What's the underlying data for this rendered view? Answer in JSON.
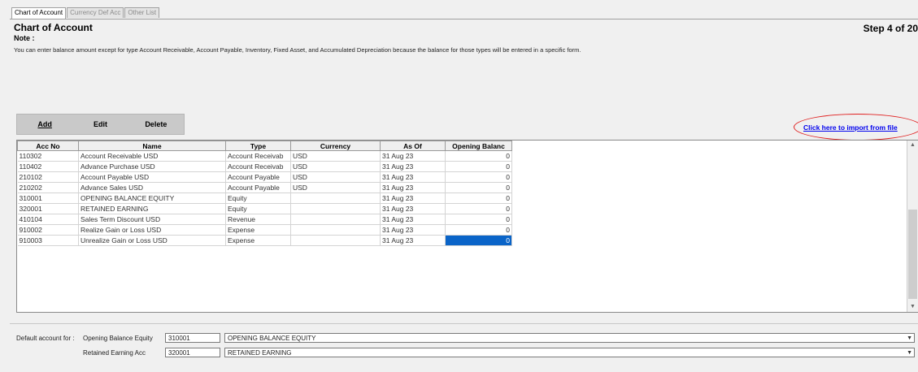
{
  "tabs": [
    "Chart of Account",
    "Currency Def Acc",
    "Other List"
  ],
  "header": {
    "title": "Chart of Account",
    "step": "Step 4 of 20"
  },
  "note": {
    "label": "Note :",
    "text": "You can enter balance amount except for type Account Receivable, Account Payable, Inventory, Fixed Asset, and Accumulated Depreciation because the balance for those types will be entered in a specific form."
  },
  "toolbar": {
    "add": "Add",
    "edit": "Edit",
    "delete": "Delete"
  },
  "import_link": "Click here to import from file",
  "grid": {
    "columns": [
      "Acc No",
      "Name",
      "Type",
      "Currency",
      "As Of",
      "Opening Balanc"
    ],
    "rows": [
      {
        "acc_no": "110302",
        "name": "Account Receivable USD",
        "type": "Account Receivab",
        "currency": "USD",
        "as_of": "31 Aug 23",
        "opening": "0"
      },
      {
        "acc_no": "110402",
        "name": "Advance Purchase USD",
        "type": "Account Receivab",
        "currency": "USD",
        "as_of": "31 Aug 23",
        "opening": "0"
      },
      {
        "acc_no": "210102",
        "name": "Account Payable USD",
        "type": "Account Payable",
        "currency": "USD",
        "as_of": "31 Aug 23",
        "opening": "0"
      },
      {
        "acc_no": "210202",
        "name": "Advance Sales USD",
        "type": "Account Payable",
        "currency": "USD",
        "as_of": "31 Aug 23",
        "opening": "0"
      },
      {
        "acc_no": "310001",
        "name": "OPENING BALANCE EQUITY",
        "type": "Equity",
        "currency": "",
        "as_of": "31 Aug 23",
        "opening": "0"
      },
      {
        "acc_no": "320001",
        "name": "RETAINED EARNING",
        "type": "Equity",
        "currency": "",
        "as_of": "31 Aug 23",
        "opening": "0"
      },
      {
        "acc_no": "410104",
        "name": "Sales Term Discount USD",
        "type": "Revenue",
        "currency": "",
        "as_of": "31 Aug 23",
        "opening": "0"
      },
      {
        "acc_no": "910002",
        "name": "Realize Gain or Loss USD",
        "type": "Expense",
        "currency": "",
        "as_of": "31 Aug 23",
        "opening": "0"
      },
      {
        "acc_no": "910003",
        "name": "Unrealize Gain or Loss USD",
        "type": "Expense",
        "currency": "",
        "as_of": "31 Aug 23",
        "opening": "0"
      }
    ]
  },
  "defaults": {
    "label": "Default account for :",
    "opening_label": "Opening Balance Equity",
    "opening_code": "310001",
    "opening_name": "OPENING BALANCE EQUITY",
    "retained_label": "Retained Earning Acc",
    "retained_code": "320001",
    "retained_name": "RETAINED EARNING"
  },
  "colors": {
    "selected": "#0a64c8",
    "link": "#0000ee",
    "highlight_oval": "#e02020"
  }
}
